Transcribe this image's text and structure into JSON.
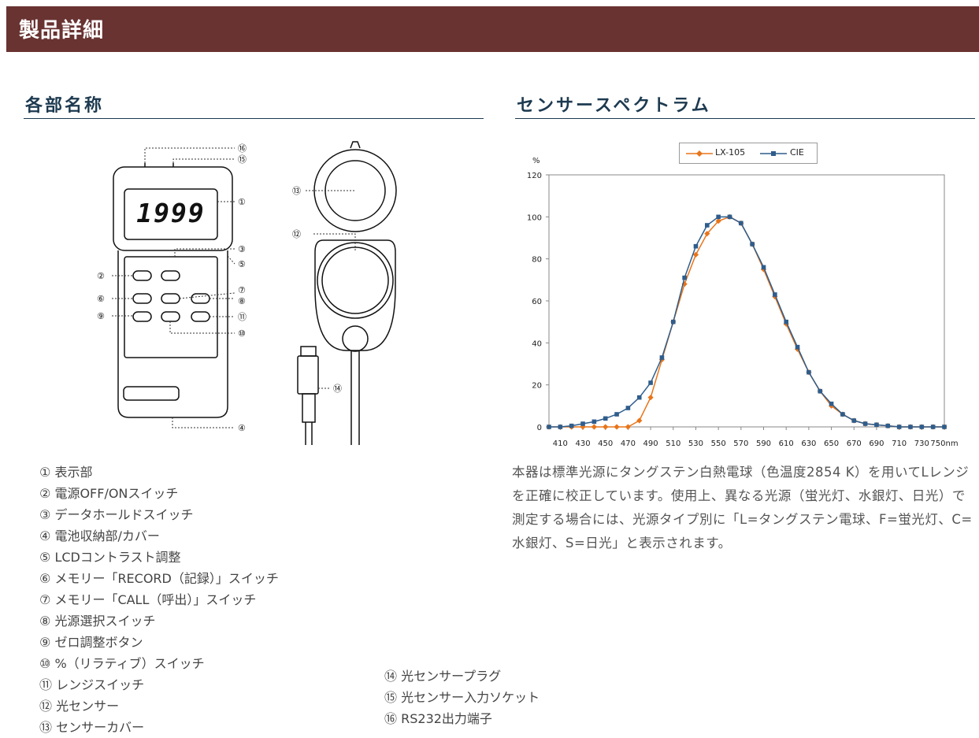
{
  "header": {
    "title": "製品詳細"
  },
  "left_section": {
    "title": "各部名称"
  },
  "right_section": {
    "title": "センサースペクトラム"
  },
  "diagram": {
    "display_reading": "1999"
  },
  "parts_list_1": [
    {
      "num": "①",
      "label": "表示部"
    },
    {
      "num": "②",
      "label": "電源OFF/ONスイッチ"
    },
    {
      "num": "③",
      "label": "データホールドスイッチ"
    },
    {
      "num": "④",
      "label": "電池収納部/カバー"
    },
    {
      "num": "⑤",
      "label": "LCDコントラスト調整"
    },
    {
      "num": "⑥",
      "label": "メモリー「RECORD（記録）」スイッチ"
    },
    {
      "num": "⑦",
      "label": "メモリー「CALL（呼出）」スイッチ"
    },
    {
      "num": "⑧",
      "label": "光源選択スイッチ"
    },
    {
      "num": "⑨",
      "label": "ゼロ調整ボタン"
    },
    {
      "num": "⑩",
      "label": "%（リラティブ）スイッチ"
    },
    {
      "num": "⑪",
      "label": "レンジスイッチ"
    },
    {
      "num": "⑫",
      "label": "光センサー"
    },
    {
      "num": "⑬",
      "label": "センサーカバー"
    }
  ],
  "parts_list_2": [
    {
      "num": "⑭",
      "label": "光センサープラグ"
    },
    {
      "num": "⑮",
      "label": "光センサー入力ソケット"
    },
    {
      "num": "⑯",
      "label": "RS232出力端子"
    }
  ],
  "chart_data": {
    "type": "line",
    "title": "",
    "xlabel": "nm",
    "ylabel": "%",
    "xlim": [
      400,
      750
    ],
    "ylim": [
      0,
      120
    ],
    "y_ticks": [
      0,
      20,
      40,
      60,
      80,
      100,
      120
    ],
    "x_ticks": [
      "410",
      "430",
      "450",
      "470",
      "490",
      "510",
      "530",
      "550",
      "570",
      "590",
      "610",
      "630",
      "650",
      "670",
      "690",
      "710",
      "730",
      "750nm"
    ],
    "grid": false,
    "legend_position": "top",
    "series": [
      {
        "name": "LX-105",
        "color": "#e8751a",
        "marker": "diamond",
        "x": [
          400,
          410,
          420,
          430,
          440,
          450,
          460,
          470,
          480,
          490,
          500,
          510,
          520,
          530,
          540,
          550,
          560,
          570,
          580,
          590,
          600,
          610,
          620,
          630,
          640,
          650,
          660,
          670,
          680,
          690,
          700,
          710,
          720,
          730,
          740,
          750
        ],
        "y": [
          0,
          0,
          0,
          0,
          0,
          0,
          0,
          0,
          3,
          14,
          32,
          50,
          68,
          82,
          92,
          98,
          100,
          97,
          87,
          75,
          62,
          49,
          37,
          26,
          17,
          10,
          6,
          3,
          1.5,
          1,
          0.5,
          0,
          0,
          0,
          0,
          0
        ]
      },
      {
        "name": "CIE",
        "color": "#2f5d8c",
        "marker": "square",
        "x": [
          400,
          410,
          420,
          430,
          440,
          450,
          460,
          470,
          480,
          490,
          500,
          510,
          520,
          530,
          540,
          550,
          560,
          570,
          580,
          590,
          600,
          610,
          620,
          630,
          640,
          650,
          660,
          670,
          680,
          690,
          700,
          710,
          720,
          730,
          740,
          750
        ],
        "y": [
          0,
          0,
          0.5,
          1.5,
          2.5,
          4,
          6,
          9,
          14,
          21,
          33,
          50,
          71,
          86,
          96,
          100,
          100,
          97,
          87,
          76,
          63,
          50,
          38,
          26,
          17,
          11,
          6,
          3,
          1.5,
          1,
          0.5,
          0,
          0,
          0,
          0,
          0
        ]
      }
    ]
  },
  "description": "本器は標準光源にタングステン白熱電球（色温度2854 K）を用いてLレンジを正確に校正しています。使用上、異なる光源（蛍光灯、水銀灯、日光）で測定する場合には、光源タイプ別に「L=タングステン電球、F=蛍光灯、C=水銀灯、S=日光」と表示されます。"
}
